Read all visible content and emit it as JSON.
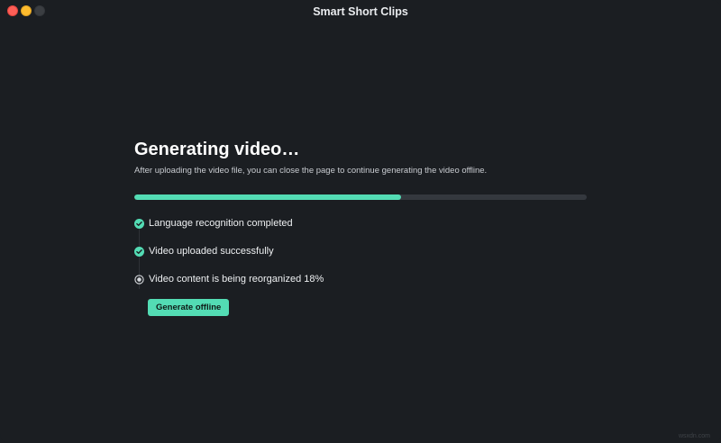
{
  "window": {
    "title": "Smart Short Clips"
  },
  "main": {
    "heading": "Generating video…",
    "subtitle": "After uploading the video file, you can close the page to continue generating the video offline.",
    "progress": 0.59,
    "steps": [
      {
        "label": "Language recognition completed",
        "status": "completed",
        "icon": "check-circle-icon"
      },
      {
        "label": "Video uploaded successfully",
        "status": "completed",
        "icon": "check-circle-icon"
      },
      {
        "label": "Video content is being reorganized 18%",
        "status": "in-progress",
        "icon": "radio-dot-icon"
      }
    ],
    "button_label": "Generate offline"
  },
  "watermark": "wsxdn.com",
  "colors": {
    "accent": "#53dcb4",
    "background": "#1b1e22",
    "track": "#34383e"
  }
}
